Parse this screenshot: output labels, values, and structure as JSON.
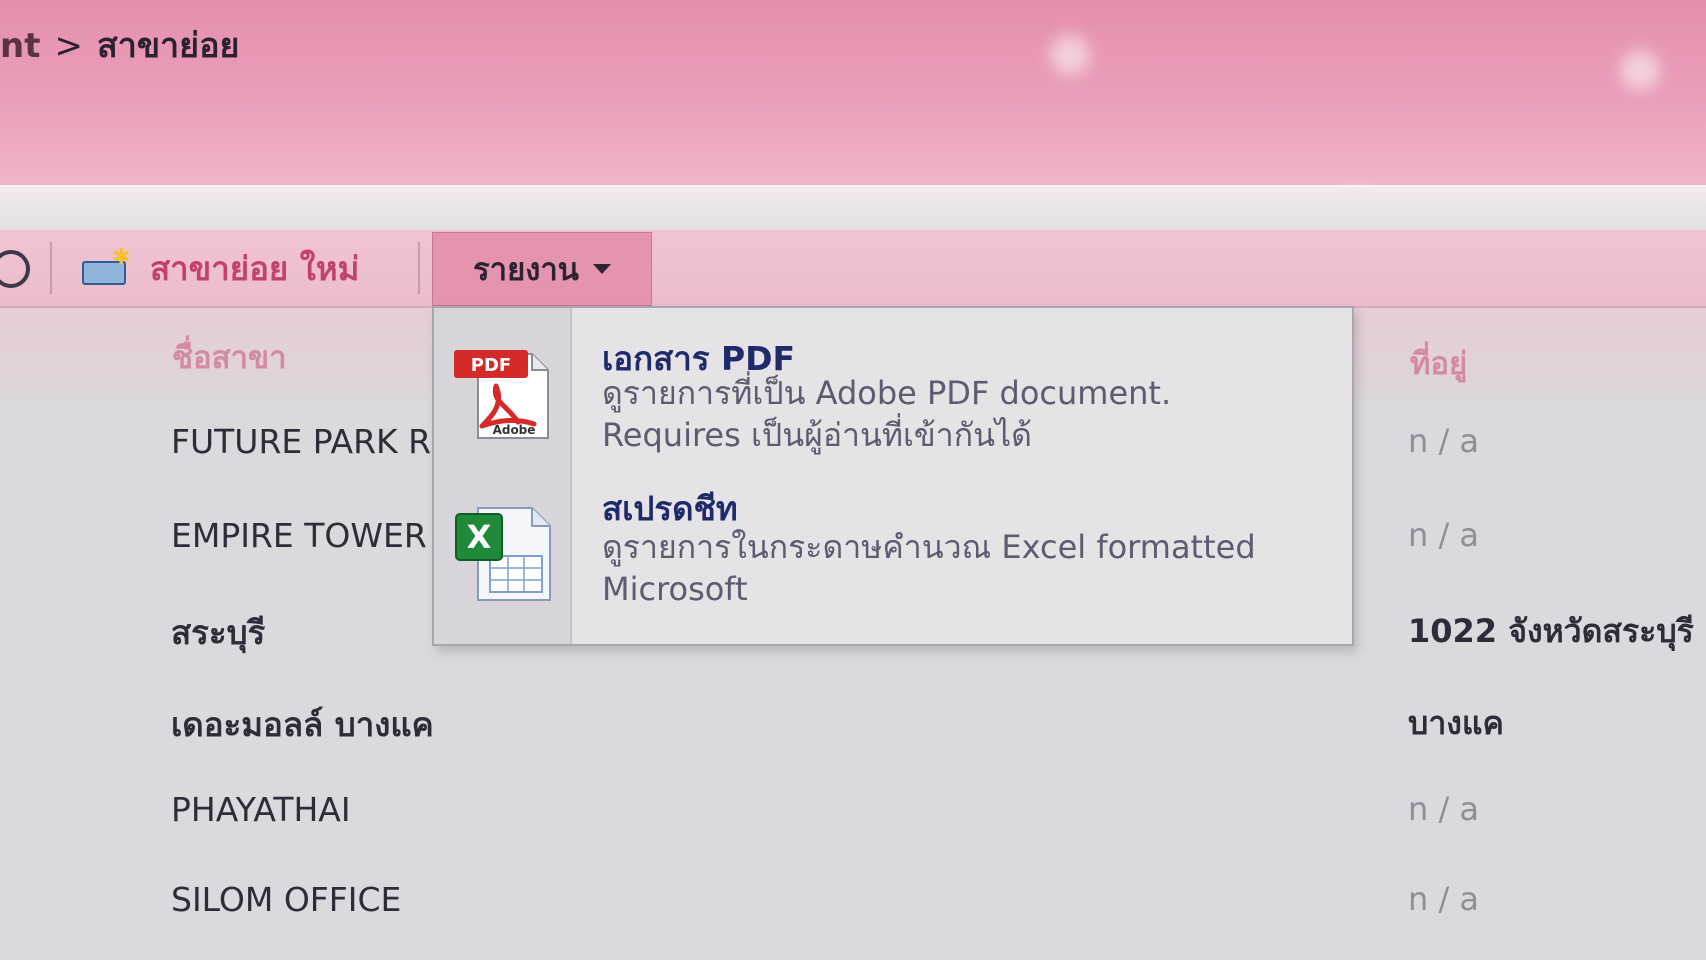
{
  "breadcrumb": {
    "prev": "nt",
    "separator": ">",
    "current": "สาขาย่อย"
  },
  "toolbar": {
    "new_label": "สาขาย่อย ใหม่",
    "report_label": "รายงาน"
  },
  "table": {
    "col_name": "ชื่อสาขา",
    "col_address": "ที่อยู่",
    "rows": [
      {
        "name": "FUTURE PARK R",
        "address": "n / a"
      },
      {
        "name": "EMPIRE TOWER",
        "address": "n / a"
      },
      {
        "name": "สระบุรี",
        "address": "1022 จังหวัดสระบุรี"
      },
      {
        "name": "เดอะมอลล์ บางแค",
        "address": "บางแค"
      },
      {
        "name": "PHAYATHAI",
        "address": "n / a"
      },
      {
        "name": "SILOM OFFICE",
        "address": "n / a"
      }
    ]
  },
  "menu": {
    "pdf": {
      "title": "เอกสาร PDF",
      "desc1": "ดูรายการที่เป็น Adobe PDF document.",
      "desc2": "Requires เป็นผู้อ่านที่เข้ากันได้",
      "badge": "PDF",
      "brand": "Adobe"
    },
    "excel": {
      "title": "สเปรดชีท",
      "desc1": "ดูรายการในกระดาษคำนวณ Excel formatted",
      "desc2": "Microsoft",
      "badge": "X"
    }
  },
  "colors": {
    "header_pink": "#e58fad",
    "accent_pink": "#c2416f",
    "menu_title_blue": "#1e2a6a",
    "pdf_red": "#d42a2a",
    "excel_green": "#1f8a3a"
  }
}
